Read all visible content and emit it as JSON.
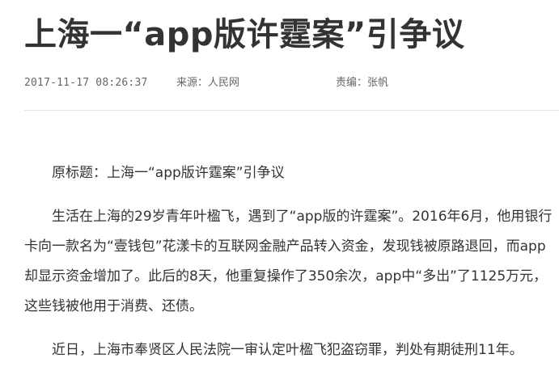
{
  "article": {
    "title": "上海一“app版许霆案”引争议",
    "meta": {
      "datetime": "2017-11-17 08:26:37",
      "source": "来源：人民网",
      "editor": "责编：张帆"
    },
    "paragraphs": [
      "原标题：上海一“app版许霆案”引争议",
      "生活在上海的29岁青年叶楹飞，遇到了“app版的许霆案”。2016年6月，他用银行卡向一款名为“壹钱包”花漾卡的互联网金融产品转入资金，发现钱被原路退回，而app却显示资金增加了。此后的8天，他重复操作了350余次，app中“多出”了1125万元，这些钱被他用于消费、还债。",
      "近日，上海市奉贤区人民法院一审认定叶楹飞犯盗窃罪，判处有期徒刑11年。"
    ]
  }
}
